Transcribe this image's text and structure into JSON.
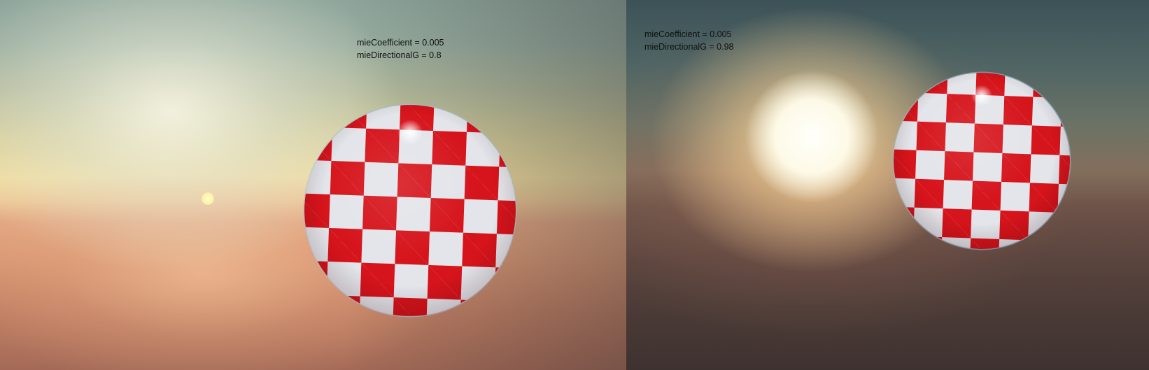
{
  "panels": [
    {
      "caption": {
        "line1": "mieCoefficient = 0.005",
        "line2": "mieDirectionalG = 0.8"
      }
    },
    {
      "caption": {
        "line1": "mieCoefficient = 0.005",
        "line2": "mieDirectionalG = 0.98"
      }
    }
  ],
  "colors": {
    "ball_red": "#d6141b",
    "ball_white": "#e3e5ea",
    "caption_text": "#111111"
  }
}
